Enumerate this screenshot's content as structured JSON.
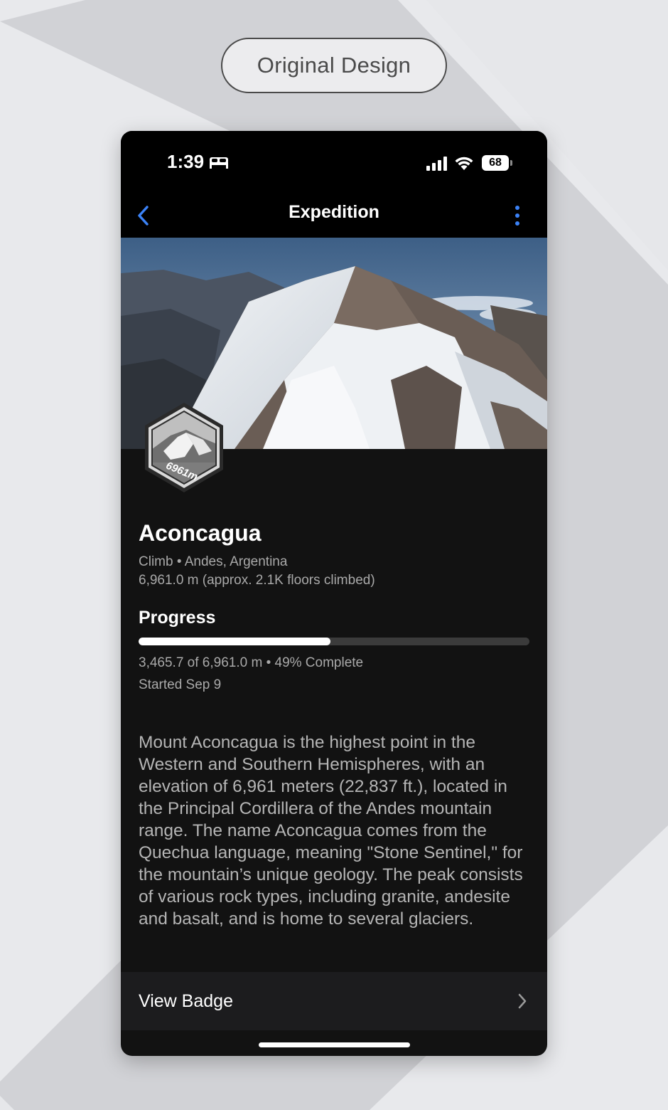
{
  "label": "Original Design",
  "status_bar": {
    "time": "1:39",
    "battery": "68"
  },
  "nav": {
    "title": "Expedition"
  },
  "expedition": {
    "badge_text": "6961m",
    "name": "Aconcagua",
    "category_location": "Climb • Andes, Argentina",
    "elevation": "6,961.0 m (approx. 2.1K floors climbed)",
    "progress_heading": "Progress",
    "progress_fraction": 0.49,
    "progress_text": "3,465.7 of 6,961.0 m • 49% Complete",
    "started": "Started Sep 9",
    "description": "Mount Aconcagua is the highest point in the Western and Southern Hemispheres, with an elevation of 6,961 meters (22,837 ft.), located in the Principal Cordillera of the Andes mountain range. The name Aconcagua comes from the Quechua language, meaning \"Stone Sentinel,\" for the mountain’s unique geology. The peak consists of various rock types, including granite, andesite and basalt, and is home to several glaciers."
  },
  "actions": {
    "view_badge": "View Badge"
  },
  "colors": {
    "accent": "#3b82f6",
    "background": "#121212",
    "row": "#1c1c1e"
  }
}
